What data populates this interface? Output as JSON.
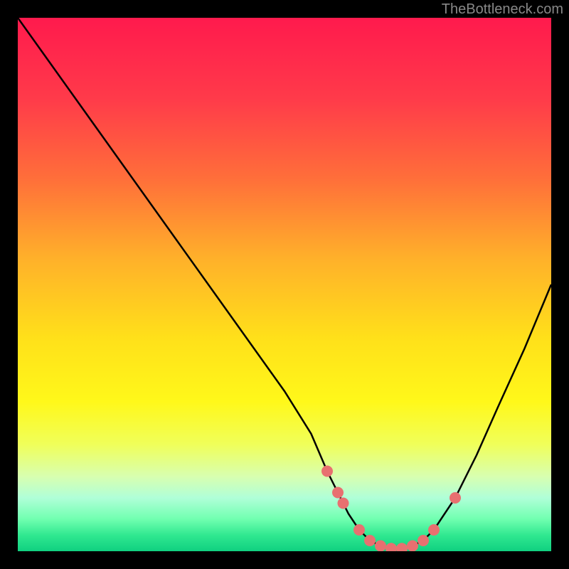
{
  "watermark": "TheBottleneck.com",
  "chart_data": {
    "type": "line",
    "title": "",
    "xlabel": "",
    "ylabel": "",
    "xlim": [
      0,
      100
    ],
    "ylim": [
      0,
      100
    ],
    "curve": {
      "x": [
        0,
        5,
        10,
        15,
        20,
        25,
        30,
        35,
        40,
        45,
        50,
        55,
        58,
        60,
        62,
        64,
        66,
        68,
        70,
        72,
        74,
        76,
        78,
        82,
        86,
        90,
        95,
        100
      ],
      "y": [
        100,
        93,
        86,
        79,
        72,
        65,
        58,
        51,
        44,
        37,
        30,
        22,
        15,
        11,
        7,
        4,
        2,
        1,
        0.5,
        0.5,
        1,
        2,
        4,
        10,
        18,
        27,
        38,
        50
      ]
    },
    "markers": {
      "x": [
        58,
        60,
        61,
        64,
        66,
        68,
        70,
        72,
        74,
        76,
        78,
        82
      ],
      "y": [
        15,
        11,
        9,
        4,
        2,
        1,
        0.5,
        0.5,
        1,
        2,
        4,
        10
      ]
    },
    "gradient_stops": [
      {
        "offset": 0.0,
        "color": "#ff1a4d"
      },
      {
        "offset": 0.15,
        "color": "#ff3a4a"
      },
      {
        "offset": 0.3,
        "color": "#ff6e3a"
      },
      {
        "offset": 0.45,
        "color": "#ffb02a"
      },
      {
        "offset": 0.6,
        "color": "#ffe01a"
      },
      {
        "offset": 0.72,
        "color": "#fff81a"
      },
      {
        "offset": 0.8,
        "color": "#f0ff5a"
      },
      {
        "offset": 0.86,
        "color": "#d8ffb0"
      },
      {
        "offset": 0.9,
        "color": "#b0ffd8"
      },
      {
        "offset": 0.94,
        "color": "#70ffb0"
      },
      {
        "offset": 0.97,
        "color": "#30e890"
      },
      {
        "offset": 1.0,
        "color": "#10d080"
      }
    ],
    "marker_color": "#e87070",
    "curve_color": "#000000"
  }
}
